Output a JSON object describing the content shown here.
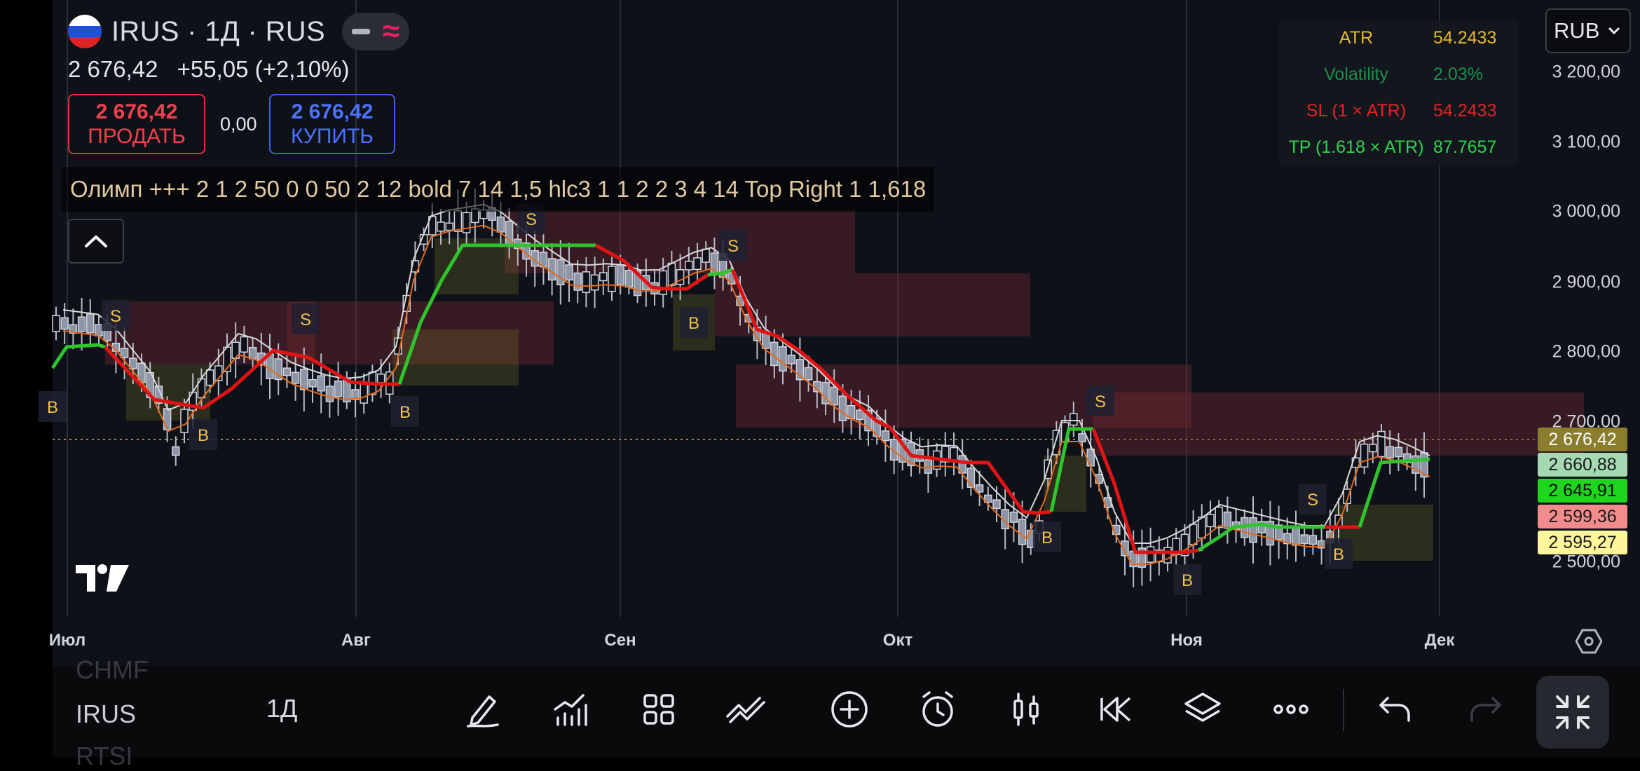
{
  "header": {
    "symbol_title": "IRUS · 1Д · RUS",
    "last_price": "2 676,42",
    "change": "+55,05 (+2,10%)",
    "study_line": "Олимп +++ 2 1 2 50 0 0 50 2 12 bold 7 14 1,5 hlc3 1 1 2 2 3 4 14 Top Right 1 1,618"
  },
  "trade": {
    "sell_price": "2 676,42",
    "sell_label": "ПРОДАТЬ",
    "spread": "0,00",
    "buy_price": "2 676,42",
    "buy_label": "КУПИТЬ"
  },
  "info_table": [
    {
      "label": "ATR",
      "value": "54.2433",
      "color": "#e6b830"
    },
    {
      "label": "Volatility",
      "value": "2.03%",
      "color": "#1e8c4e"
    },
    {
      "label": "SL (1 × ATR)",
      "value": "54.2433",
      "color": "#e02424"
    },
    {
      "label": "TP (1.618 × ATR)",
      "value": "87.7657",
      "color": "#2fd24d"
    }
  ],
  "currency": "RUB",
  "y_axis": [
    "3 200,00",
    "3 100,00",
    "3 000,00",
    "2 900,00",
    "2 800,00",
    "2 700,00",
    "2 500,00"
  ],
  "price_tags": [
    {
      "text": "2 676,42",
      "bg": "#8a7d2e",
      "fg": "#ffffff"
    },
    {
      "text": "2 660,88",
      "bg": "#a6d8b4",
      "fg": "#1a1a1a"
    },
    {
      "text": "2 645,91",
      "bg": "#1fd61f",
      "fg": "#0a0a0a"
    },
    {
      "text": "2 599,36",
      "bg": "#f28b8b",
      "fg": "#1a1a1a"
    },
    {
      "text": "2 595,27",
      "bg": "#fff59a",
      "fg": "#1a1a1a"
    }
  ],
  "x_axis": [
    "Июл",
    "Авг",
    "Сен",
    "Окт",
    "Ноя",
    "Дек"
  ],
  "signals": {
    "sell": "S",
    "buy": "B"
  },
  "watchlist": {
    "prev": "CHMF",
    "current": "IRUS",
    "next": "RTSI"
  },
  "timeframe": "1Д",
  "toolbar_icons": [
    "pencil-icon",
    "indicators-icon",
    "grid-icon",
    "trendline-icon",
    "plus-circle-icon",
    "alarm-icon",
    "candles-icon",
    "replay-icon",
    "layers-icon",
    "more-icon",
    "undo-icon",
    "redo-icon",
    "fullscreen-exit-icon"
  ],
  "colors": {
    "sell": "#f0404d",
    "buy": "#4a73ff",
    "up_trend": "#2ec42e",
    "down_trend": "#e01414",
    "signal_label": "#f2c24a"
  }
}
